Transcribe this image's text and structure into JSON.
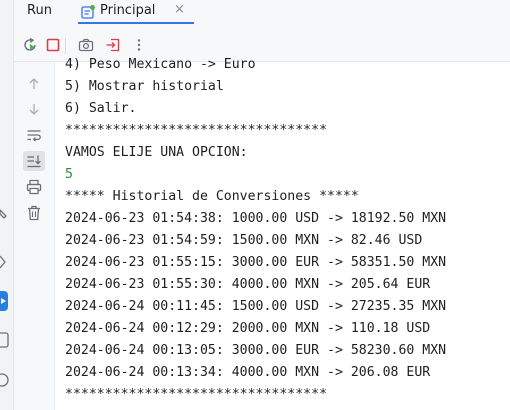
{
  "header": {
    "run_label": "Run",
    "tab_label": "Principal",
    "tab_close": "×"
  },
  "toolbar": {
    "buttons": [
      "rerun-icon",
      "stop-icon",
      "camera-icon",
      "exit-icon",
      "more-vertical-icon"
    ]
  },
  "gutter": {
    "buttons": [
      "arrow-up-icon",
      "arrow-down-icon",
      "soft-wrap-icon",
      "scroll-to-end-icon",
      "print-icon",
      "trash-icon"
    ]
  },
  "console": {
    "lines": [
      "4) Peso Mexicano -> Euro",
      "5) Mostrar historial",
      "6) Salir.",
      "*********************************",
      "VAMOS ELIJE UNA OPCION:",
      "5",
      "***** Historial de Conversiones *****",
      "2024-06-23 01:54:38: 1000.00 USD -> 18192.50 MXN",
      "2024-06-23 01:54:59: 1500.00 MXN -> 82.46 USD",
      "2024-06-23 01:55:15: 3000.00 EUR -> 58351.50 MXN",
      "2024-06-23 01:55:30: 4000.00 MXN -> 205.64 EUR",
      "2024-06-24 00:11:45: 1500.00 USD -> 27235.35 MXN",
      "2024-06-24 00:12:29: 2000.00 MXN -> 110.18 USD",
      "2024-06-24 00:13:05: 3000.00 EUR -> 58230.60 MXN",
      "2024-06-24 00:13:34: 4000.00 MXN -> 206.08 EUR",
      "*********************************"
    ]
  },
  "colors": {
    "accent": "#3574f0",
    "input_text": "#2e8b3a",
    "stop_red": "#db3b4b"
  }
}
